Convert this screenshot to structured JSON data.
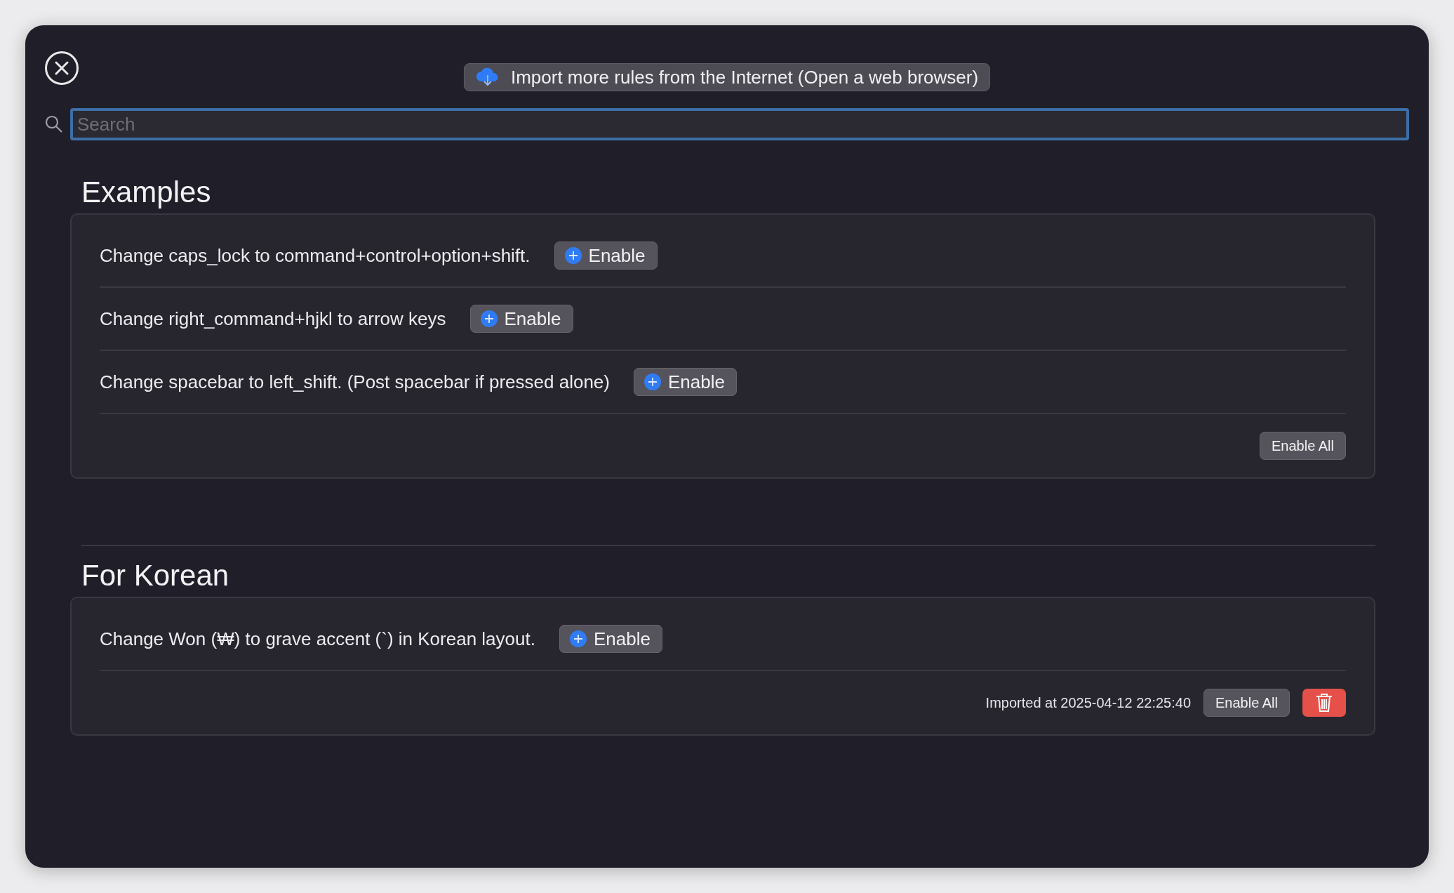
{
  "import_button": {
    "label": "Import more rules from the Internet (Open a web browser)"
  },
  "search": {
    "placeholder": "Search"
  },
  "sections": [
    {
      "title": "Examples",
      "rules": [
        {
          "text": "Change caps_lock to command+control+option+shift.",
          "button": "Enable"
        },
        {
          "text": "Change right_command+hjkl to arrow keys",
          "button": "Enable"
        },
        {
          "text": "Change spacebar to left_shift. (Post spacebar if pressed alone)",
          "button": "Enable"
        }
      ],
      "actions": [
        {
          "kind": "button",
          "label": "Enable All"
        }
      ]
    },
    {
      "title": "For Korean",
      "rules": [
        {
          "text": "Change Won (₩) to grave accent (`) in Korean layout.",
          "button": "Enable"
        }
      ],
      "imported": "Imported at 2025-04-12 22:25:40",
      "actions": [
        {
          "kind": "button",
          "label": "Enable All"
        },
        {
          "kind": "delete"
        }
      ]
    }
  ]
}
